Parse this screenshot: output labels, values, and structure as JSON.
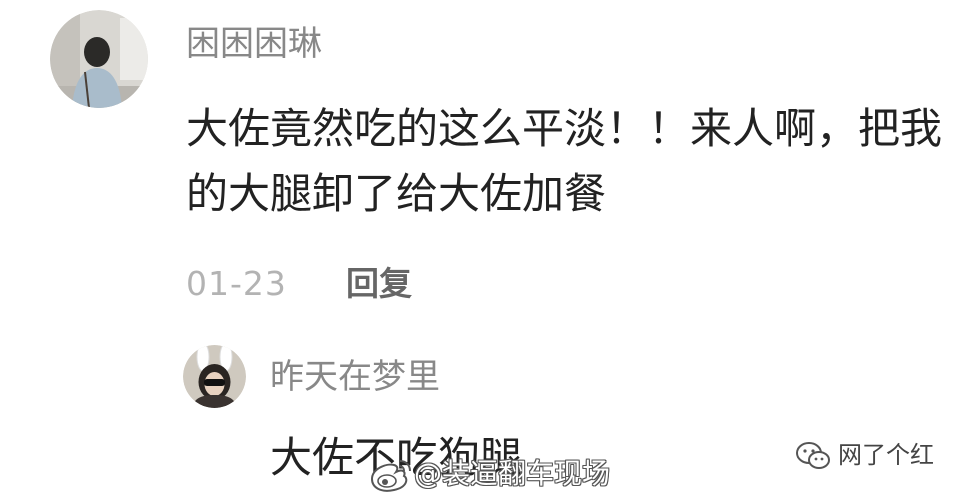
{
  "comment": {
    "avatar_icon": "user-avatar-photo",
    "username": "困困困琳",
    "text_lines": [
      "大佐竟然吃的这么平淡！！来人啊，把我",
      "的大腿卸了给大佐加餐"
    ],
    "date": "01-23",
    "reply_label": "回复"
  },
  "reply": {
    "avatar_icon": "bunny-ears-avatar",
    "username": "昨天在梦里",
    "text": "大佐不吃狗腿"
  },
  "watermarks": {
    "weibo_icon": "weibo-logo-icon",
    "weibo_text": "@装逼翻车现场",
    "wechat_icon": "wechat-icon",
    "wechat_text": "网了个红"
  },
  "colors": {
    "bg": "#ffffff",
    "username": "#888888",
    "text": "#222222",
    "date": "#b3b3b3",
    "reply": "#666666"
  }
}
